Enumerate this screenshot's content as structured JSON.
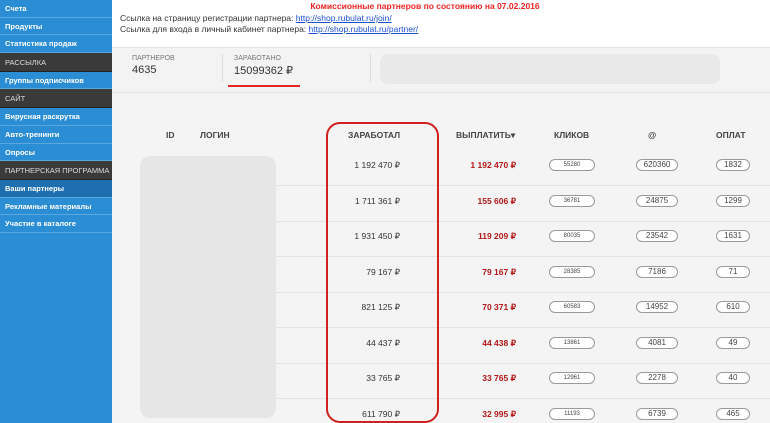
{
  "sidebar": {
    "items": [
      {
        "label": "Счета",
        "style": "blue"
      },
      {
        "label": "Продукты",
        "style": "blue"
      },
      {
        "label": "Статистика продаж",
        "style": "blue"
      },
      {
        "label": "РАССЫЛКА",
        "style": "dark"
      },
      {
        "label": "Группы подписчиков",
        "style": "blue"
      },
      {
        "label": "САЙТ",
        "style": "dark"
      },
      {
        "label": "Вирусная раскрутка",
        "style": "blue"
      },
      {
        "label": "Авто-тренинги",
        "style": "blue"
      },
      {
        "label": "Опросы",
        "style": "blue"
      },
      {
        "label": "ПАРТНЕРСКАЯ ПРОГРАММА",
        "style": "dark"
      },
      {
        "label": "Ваши партнеры",
        "style": "active"
      },
      {
        "label": "Рекламные материалы",
        "style": "blue"
      },
      {
        "label": "Участие в каталоге",
        "style": "blue"
      }
    ]
  },
  "banner": "Комиссионные партнеров по состоянию на 07.02.2016",
  "links": {
    "register_text": "Ссылка на страницу регистрации партнера:",
    "register_url": "http://shop.rubulat.ru/join/",
    "cabinet_text": "Ссылка для входа в личный кабинет партнера:",
    "cabinet_url": "http://shop.rubulat.ru/partner/"
  },
  "stats": {
    "partners_label": "ПАРТНЕРОВ",
    "partners_value": "4635",
    "earned_label": "ЗАРАБОТАНО",
    "earned_value": "15099362 ₽"
  },
  "table": {
    "headers": {
      "id": "ID",
      "login": "ЛОГИН",
      "earned": "ЗАРАБОТАЛ",
      "payout": "ВЫПЛАТИТЬ▾",
      "clicks": "КЛИКОВ",
      "at": "@",
      "payments": "ОПЛАТ"
    },
    "rows": [
      {
        "earned": "1 192 470 ₽",
        "payout": "1 192 470 ₽",
        "clicks": "55280",
        "at": "620360",
        "payments": "1832"
      },
      {
        "earned": "1 711 361 ₽",
        "payout": "155 606 ₽",
        "clicks": "36781",
        "at": "24875",
        "payments": "1299"
      },
      {
        "earned": "1 931 450 ₽",
        "payout": "119 209 ₽",
        "clicks": "80035",
        "at": "23542",
        "payments": "1631"
      },
      {
        "earned": "79 167 ₽",
        "payout": "79 167 ₽",
        "clicks": "28385",
        "at": "7186",
        "payments": "71"
      },
      {
        "earned": "821 125 ₽",
        "payout": "70 371 ₽",
        "clicks": "60583",
        "at": "14952",
        "payments": "610"
      },
      {
        "earned": "44 437 ₽",
        "payout": "44 438 ₽",
        "clicks": "13861",
        "at": "4081",
        "payments": "49"
      },
      {
        "earned": "33 765 ₽",
        "payout": "33 765 ₽",
        "clicks": "12961",
        "at": "2278",
        "payments": "40"
      },
      {
        "earned": "611 790 ₽",
        "payout": "32 995 ₽",
        "clicks": "11193",
        "at": "6739",
        "payments": "465"
      }
    ]
  },
  "colors": {
    "sidebar": "#2b8dd4",
    "dark_section": "#3a3a3a",
    "payout": "#b31818",
    "highlight": "#d12020"
  }
}
